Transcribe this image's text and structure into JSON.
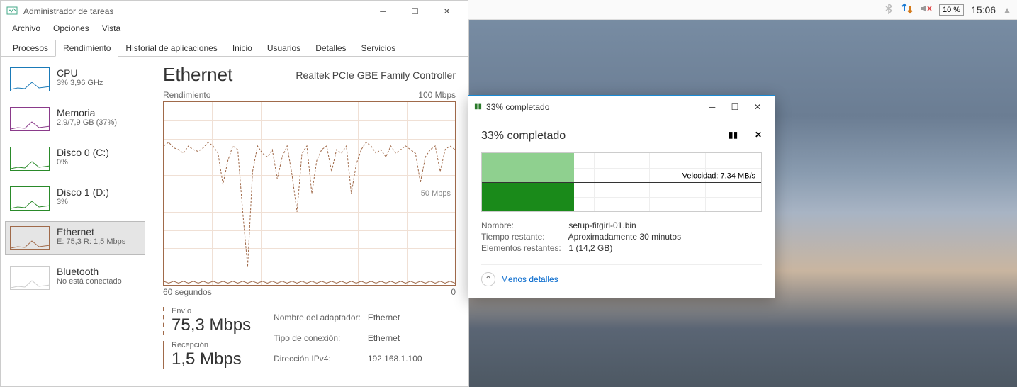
{
  "taskmgr": {
    "title": "Administrador de tareas",
    "menu": [
      "Archivo",
      "Opciones",
      "Vista"
    ],
    "tabs": [
      "Procesos",
      "Rendimiento",
      "Historial de aplicaciones",
      "Inicio",
      "Usuarios",
      "Detalles",
      "Servicios"
    ],
    "active_tab": 1,
    "sidebar": [
      {
        "name": "CPU",
        "sub": "3% 3,96 GHz",
        "color": "#1a7ab8"
      },
      {
        "name": "Memoria",
        "sub": "2,9/7,9 GB (37%)",
        "color": "#8a3a8a"
      },
      {
        "name": "Disco 0 (C:)",
        "sub": "0%",
        "color": "#2a8a2a"
      },
      {
        "name": "Disco 1 (D:)",
        "sub": "3%",
        "color": "#2a8a2a"
      },
      {
        "name": "Ethernet",
        "sub": "E: 75,3 R: 1,5 Mbps",
        "color": "#a06a4a",
        "selected": true
      },
      {
        "name": "Bluetooth",
        "sub": "No está conectado",
        "color": "#ccc"
      }
    ],
    "main": {
      "heading": "Ethernet",
      "adapter": "Realtek PCIe GBE Family Controller",
      "chart_top_left": "Rendimiento",
      "chart_top_right": "100 Mbps",
      "chart_mid": "50 Mbps",
      "chart_bot_left": "60 segundos",
      "chart_bot_right": "0",
      "send_label": "Envío",
      "send_value": "75,3 Mbps",
      "recv_label": "Recepción",
      "recv_value": "1,5 Mbps",
      "details": [
        [
          "Nombre del adaptador:",
          "Ethernet"
        ],
        [
          "Tipo de conexión:",
          "Ethernet"
        ],
        [
          "Dirección IPv4:",
          "192.168.1.100"
        ]
      ]
    }
  },
  "tray": {
    "battery": "10 %",
    "clock": "15:06"
  },
  "copydlg": {
    "titlebar": "33% completado",
    "heading": "33% completado",
    "progress_pct": 33,
    "speed_label": "Velocidad: 7,34 MB/s",
    "meta": [
      {
        "k": "Nombre:",
        "v": "setup-fitgirl-01.bin"
      },
      {
        "k": "Tiempo restante:",
        "v": "Aproximadamente 30 minutos"
      },
      {
        "k": "Elementos restantes:",
        "v": "1 (14,2 GB)"
      }
    ],
    "less": "Menos detalles"
  },
  "chart_data": {
    "type": "line",
    "title": "Ethernet Rendimiento",
    "xlabel": "60 segundos",
    "ylabel": "Mbps",
    "ylim": [
      0,
      100
    ],
    "series": [
      {
        "name": "Envío",
        "values": [
          76,
          78,
          75,
          74,
          72,
          76,
          74,
          73,
          75,
          78,
          76,
          72,
          55,
          68,
          76,
          74,
          40,
          10,
          62,
          76,
          72,
          70,
          74,
          58,
          70,
          76,
          60,
          40,
          72,
          76,
          50,
          68,
          74,
          76,
          62,
          74,
          72,
          76,
          50,
          66,
          74,
          78,
          76,
          72,
          74,
          70,
          76,
          72,
          74,
          76,
          74,
          72,
          56,
          70,
          74,
          76,
          62,
          74,
          76,
          74
        ]
      },
      {
        "name": "Recepción",
        "values": [
          2,
          1,
          2,
          1,
          2,
          1,
          2,
          1,
          2,
          1,
          2,
          1,
          2,
          1,
          2,
          1,
          2,
          1,
          2,
          1,
          2,
          1,
          2,
          1,
          2,
          1,
          2,
          1,
          2,
          1,
          2,
          1,
          2,
          1,
          2,
          1,
          2,
          1,
          2,
          1,
          2,
          1,
          2,
          1,
          2,
          1,
          2,
          1,
          2,
          1,
          2,
          1,
          2,
          1,
          2,
          1,
          2,
          1,
          2,
          1
        ]
      }
    ]
  }
}
